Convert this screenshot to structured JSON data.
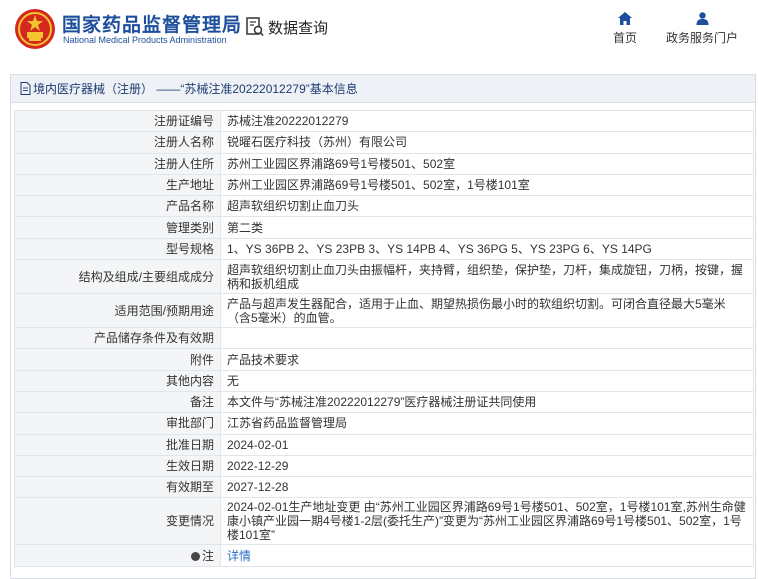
{
  "header": {
    "brand_cn": "国家药品监督管理局",
    "brand_en": "National Medical Products Administration",
    "query_label": "数据查询",
    "nav": {
      "home": "首页",
      "portal": "政务服务门户"
    }
  },
  "title_bar": {
    "text": "境内医疗器械（注册） ——“苏械注准20222012279”基本信息"
  },
  "rows": [
    {
      "label": "注册证编号",
      "value": "苏械注准20222012279"
    },
    {
      "label": "注册人名称",
      "value": "锐曜石医疗科技（苏州）有限公司"
    },
    {
      "label": "注册人住所",
      "value": "苏州工业园区界浦路69号1号楼501、502室"
    },
    {
      "label": "生产地址",
      "value": "苏州工业园区界浦路69号1号楼501、502室，1号楼101室"
    },
    {
      "label": "产品名称",
      "value": "超声软组织切割止血刀头"
    },
    {
      "label": "管理类别",
      "value": "第二类"
    },
    {
      "label": "型号规格",
      "value": "1、YS 36PB 2、YS 23PB 3、YS 14PB 4、YS 36PG 5、YS 23PG 6、YS 14PG"
    },
    {
      "label": "结构及组成/主要组成成分",
      "value": "超声软组织切割止血刀头由振幅杆，夹持臂，组织垫，保护垫，刀杆，集成旋钮，刀柄，按键，握柄和扳机组成"
    },
    {
      "label": "适用范围/预期用途",
      "value": "产品与超声发生器配合，适用于止血、期望热损伤最小时的软组织切割。可闭合直径最大5毫米（含5毫米）的血管。"
    },
    {
      "label": "产品储存条件及有效期",
      "value": ""
    },
    {
      "label": "附件",
      "value": "产品技术要求"
    },
    {
      "label": "其他内容",
      "value": "无"
    },
    {
      "label": "备注",
      "value": "本文件与“苏械注准20222012279”医疗器械注册证共同使用"
    },
    {
      "label": "审批部门",
      "value": "江苏省药品监督管理局"
    },
    {
      "label": "批准日期",
      "value": "2024-02-01"
    },
    {
      "label": "生效日期",
      "value": "2022-12-29"
    },
    {
      "label": "有效期至",
      "value": "2027-12-28"
    },
    {
      "label": "变更情况",
      "value": "2024-02-01生产地址变更 由“苏州工业园区界浦路69号1号楼501、502室，1号楼101室,苏州生命健康小镇产业园一期4号楼1-2层(委托生产)”变更为“苏州工业园区界浦路69号1号楼501、502室，1号楼101室”"
    }
  ],
  "note_row": {
    "label": "注",
    "link": "详情",
    "icon": "pin-icon"
  },
  "colors": {
    "brand_blue": "#1e4f9c",
    "link_blue": "#2b6fc4",
    "label_bg": "#f3f5f7",
    "title_bg": "#eef2f6"
  }
}
